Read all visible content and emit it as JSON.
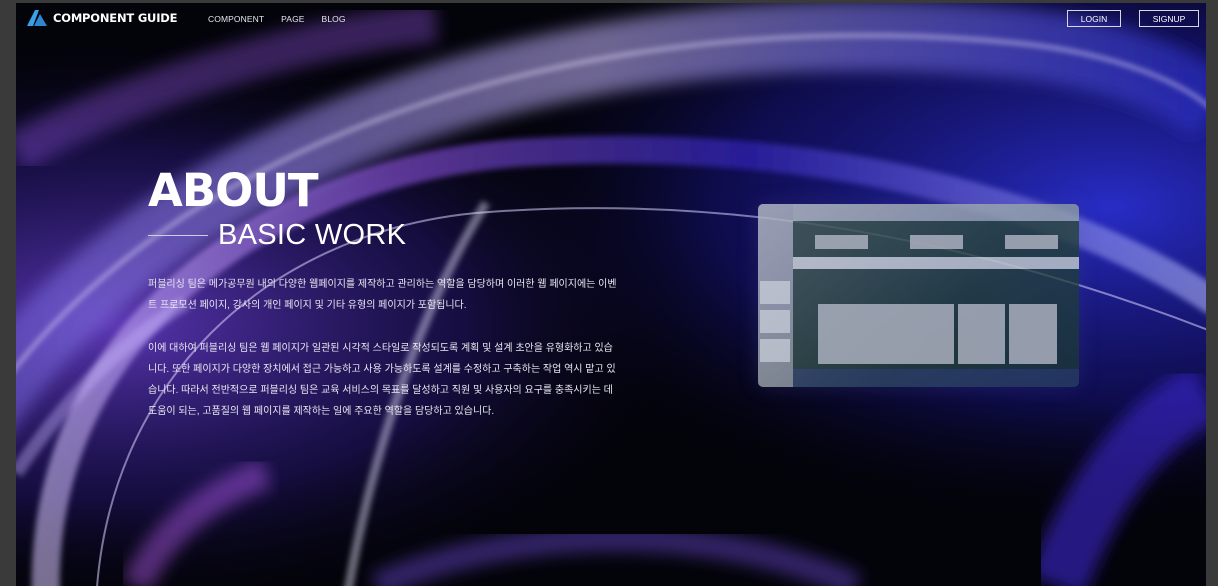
{
  "header": {
    "brand": "COMPONENT GUIDE",
    "logo_icon": "triangle-logo-icon",
    "nav": [
      "COMPONENT",
      "PAGE",
      "BLOG"
    ],
    "login_label": "LOGIN",
    "signup_label": "SIGNUP"
  },
  "hero": {
    "title": "ABOUT",
    "subtitle": "BASIC WORK",
    "paragraph1": "퍼블리싱 팀은 메가공무원 내의 다양한 웹페이지를 제작하고 관리하는 역할을 담당하며 이러한 웹 페이지에는 이벤트 프로모션 페이지, 강사의 개인 페이지 및 기타 유형의 페이지가 포함됩니다.",
    "paragraph2": "이에 대하여 퍼블리싱 팀은 웹 페이지가 일관된 시각적 스타일로 작성되도록 계획 및 설계 초안을 유형화하고 있습니다. 또한 페이지가 다양한 장치에서 접근 가능하고 사용 가능하도록 설계를 수정하고 구축하는 작업 역시 맡고 있습니다. 따라서 전반적으로 퍼블리싱 팀은 교육 서비스의 목표를 달성하고 직원 및 사용자의 요구를 충족시키는 데 도움이 되는, 고품질의 웹 페이지를 제작하는 일에 주요한 역할을 담당하고 있습니다."
  },
  "colors": {
    "background": "#03030a",
    "accent_blue": "#2a2fd0",
    "accent_purple": "#8a3fd8",
    "logo_blue": "#3aa0e8"
  }
}
